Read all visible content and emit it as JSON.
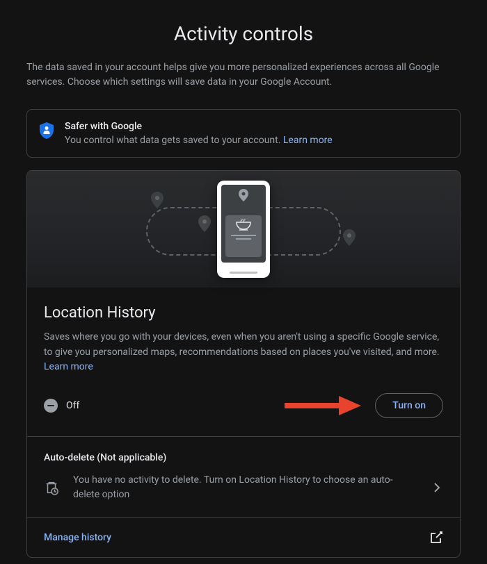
{
  "header": {
    "title": "Activity controls",
    "subtitle": "The data saved in your account helps give you more personalized experiences across all Google services. Choose which settings will save data in your Google Account."
  },
  "banner": {
    "title": "Safer with Google",
    "text": "You control what data gets saved to your account. ",
    "learn_more": "Learn more"
  },
  "location_history": {
    "title": "Location History",
    "description": "Saves where you go with your devices, even when you aren't using a specific Google service, to give you personalized maps, recommendations based on places you've visited, and more. ",
    "learn_more": "Learn more",
    "status_label": "Off",
    "turn_on_label": "Turn on"
  },
  "auto_delete": {
    "title": "Auto-delete (Not applicable)",
    "description": "You have no activity to delete. Turn on Location History to choose an auto-delete option"
  },
  "manage_history": {
    "label": "Manage history"
  }
}
